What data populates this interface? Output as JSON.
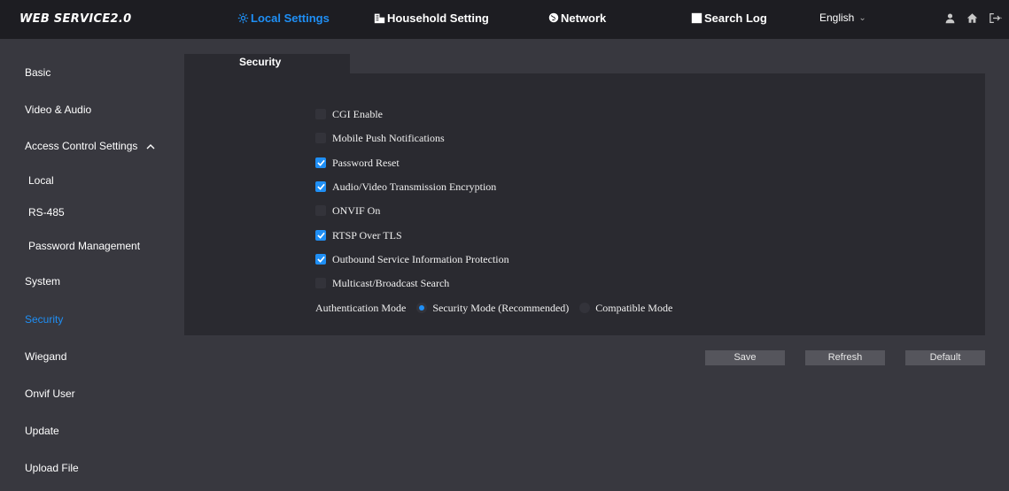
{
  "app": {
    "title": "WEB SERVICE2.0"
  },
  "topnav": {
    "local_settings": "Local Settings",
    "household_setting": "Household Setting",
    "network": "Network",
    "search_log": "Search Log",
    "language": "English"
  },
  "sidebar": {
    "items": [
      {
        "label": "Basic"
      },
      {
        "label": "Video & Audio"
      },
      {
        "label": "Access Control Settings"
      },
      {
        "label": "Local"
      },
      {
        "label": "RS-485"
      },
      {
        "label": "Password Management"
      },
      {
        "label": "System"
      },
      {
        "label": "Security",
        "active": true
      },
      {
        "label": "Wiegand"
      },
      {
        "label": "Onvif User"
      },
      {
        "label": "Update"
      },
      {
        "label": "Upload File"
      }
    ]
  },
  "tab": {
    "label": "Security"
  },
  "options": [
    {
      "label": "CGI Enable",
      "checked": false
    },
    {
      "label": "Mobile Push Notifications",
      "checked": false
    },
    {
      "label": "Password Reset",
      "checked": true
    },
    {
      "label": "Audio/Video Transmission Encryption",
      "checked": true
    },
    {
      "label": "ONVIF On",
      "checked": false
    },
    {
      "label": "RTSP Over TLS",
      "checked": true
    },
    {
      "label": "Outbound Service Information Protection",
      "checked": true
    },
    {
      "label": "Multicast/Broadcast Search",
      "checked": false
    }
  ],
  "auth": {
    "label": "Authentication Mode",
    "security_mode": "Security Mode (Recommended)",
    "compatible_mode": "Compatible Mode",
    "selected": "Security Mode (Recommended)"
  },
  "buttons": {
    "save": "Save",
    "refresh": "Refresh",
    "default": "Default"
  },
  "colors": {
    "accent": "#1f8ff5",
    "topbar": "#1d1d22",
    "background": "#38383f",
    "panel": "#2a2a30"
  },
  "icons": [
    "gear-icon",
    "building-icon",
    "globe-icon",
    "document-icon",
    "user-icon",
    "home-icon",
    "logout-icon",
    "chevron-up-icon",
    "check-icon",
    "chevron-down-icon"
  ]
}
